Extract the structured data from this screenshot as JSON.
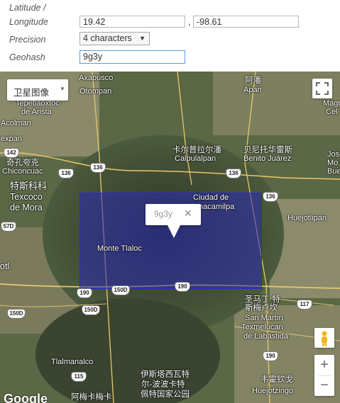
{
  "form": {
    "latitude_label_line1": "Latitude /",
    "longitude_label_line2": "Longitude",
    "latitude_value": "19.42",
    "separator": ",",
    "longitude_value": "-98.61",
    "precision_label": "Precision",
    "precision_value": "4 characters",
    "geohash_label": "Geohash",
    "geohash_value": "9g3y"
  },
  "map": {
    "map_type_label": "卫星图像",
    "infowindow_text": "9g3y",
    "close_glyph": "✕",
    "zoom_in": "+",
    "zoom_out": "−",
    "logo": "Google",
    "places": [
      "Axapusco",
      "Otompan",
      "阿潘",
      "Apan",
      "Tepetlaoxtoc",
      "de Arista",
      "Acolman",
      "expan",
      "卡尔普拉尔潘",
      "Calpulalpan",
      "贝尼托华雷斯",
      "Benito Juárez",
      "奇孔夸克",
      "Chiconcuac",
      "特斯科科",
      "Texcoco",
      "de Mora",
      "Ciudad de",
      "Nanacamilpa",
      "Huejotlipan",
      "Monte Tlaloc",
      "otl",
      "圣马丁·特",
      "斯梅卢坎",
      "San Martín",
      "Texmelucan",
      "de Labastida",
      "Tlalmanalco",
      "伊斯塔西瓦特",
      "尔-波波卡特",
      "佩特国家公园",
      "韦霍钦戈",
      "Huejotzingo",
      "阿梅卡梅卡",
      "Magu",
      "Cel",
      "Jose",
      "Mo",
      "Bue"
    ],
    "shields": [
      "142",
      "136",
      "136",
      "136",
      "57D",
      "136",
      "190",
      "150D",
      "190",
      "117",
      "150D",
      "150D",
      "190",
      "115"
    ]
  }
}
